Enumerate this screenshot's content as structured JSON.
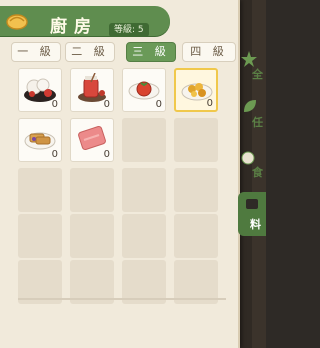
{
  "header": {
    "title": "廚房",
    "level": "等級: 5"
  },
  "tabs": [
    {
      "label": "一 級",
      "active": false
    },
    {
      "label": "二 級",
      "active": false
    },
    {
      "label": "三 級",
      "active": true
    },
    {
      "label": "四 級",
      "active": false
    }
  ],
  "items": [
    {
      "icon": "rice-cake-dessert-icon",
      "count": "0"
    },
    {
      "icon": "red-drink-icon",
      "count": "0"
    },
    {
      "icon": "tomato-dish-icon",
      "count": "0"
    },
    {
      "icon": "fried-dish-icon",
      "count": "0"
    },
    {
      "icon": "bread-dish-icon",
      "count": "0"
    },
    {
      "icon": "pink-slab-icon",
      "count": "0"
    }
  ],
  "side": {
    "all_label": "全",
    "task_label": "任",
    "food_label": "食",
    "material_label": "料"
  },
  "colors": {
    "accent": "#5f8d4f",
    "selected_border": "#f0c84b"
  }
}
